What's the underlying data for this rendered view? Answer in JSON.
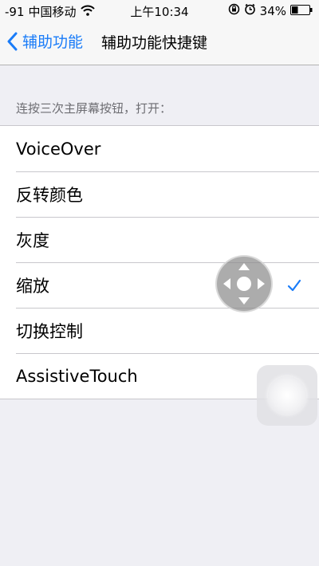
{
  "status_bar": {
    "signal": "-91",
    "carrier": "中国移动",
    "time": "上午10:34",
    "battery": "34%",
    "icons": [
      "wifi-icon",
      "rotation-lock-icon",
      "alarm-icon",
      "battery-icon"
    ]
  },
  "nav": {
    "back_label": "辅助功能",
    "title": "辅助功能快捷键"
  },
  "section": {
    "header": "连按三次主屏幕按钮，打开："
  },
  "options": [
    {
      "label": "VoiceOver",
      "checked": false
    },
    {
      "label": "反转颜色",
      "checked": false
    },
    {
      "label": "灰度",
      "checked": false
    },
    {
      "label": "缩放",
      "checked": true
    },
    {
      "label": "切换控制",
      "checked": false
    },
    {
      "label": "AssistiveTouch",
      "checked": false
    }
  ],
  "colors": {
    "accent": "#1a7cf8",
    "background": "#efeff4",
    "separator": "#c8c7cc"
  }
}
